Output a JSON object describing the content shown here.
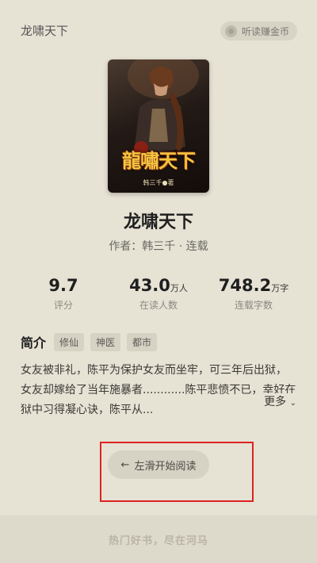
{
  "header": {
    "title": "龙啸天下",
    "listen_label": "听读赚金币"
  },
  "cover": {
    "title_art": "龍嘯天下",
    "author_art": "韩三千●著"
  },
  "book": {
    "title": "龙啸天下",
    "meta": "作者：韩三千 · 连载"
  },
  "stats": [
    {
      "value": "9.7",
      "unit": "",
      "label": "评分"
    },
    {
      "value": "43.0",
      "unit": "万人",
      "label": "在读人数"
    },
    {
      "value": "748.2",
      "unit": "万字",
      "label": "连载字数"
    }
  ],
  "intro": {
    "heading": "简介",
    "tags": [
      "修仙",
      "神医",
      "都市"
    ],
    "synopsis": "女友被非礼，陈平为保护女友而坐牢，可三年后出狱，女友却嫁给了当年施暴者............陈平悲愤不已，幸好在狱中习得凝心诀，陈平从...",
    "more_label": "更多"
  },
  "start_button": {
    "label": "左滑开始阅读",
    "icon": "arrow-left-icon"
  },
  "footer": {
    "text": "热门好书，尽在河马"
  },
  "colors": {
    "background": "#e6e2d4",
    "highlight": "#dd2222"
  }
}
